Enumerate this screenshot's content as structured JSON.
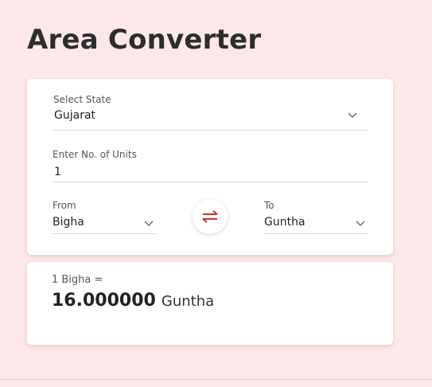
{
  "page_title": "Area Converter",
  "form": {
    "state_label": "Select State",
    "state_value": "Gujarat",
    "units_label": "Enter No. of Units",
    "units_value": "1",
    "from_label": "From",
    "from_value": "Bigha",
    "to_label": "To",
    "to_value": "Guntha",
    "swap_icon": "swap-arrows-icon",
    "chevron_icon": "chevron-down-icon"
  },
  "result": {
    "caption": "1 Bigha =",
    "value": "16.000000",
    "unit": "Guntha"
  },
  "colors": {
    "background": "#fde8e9",
    "card": "#ffffff",
    "swap_icon": "#d32f2f",
    "title": "#2d2d2d"
  }
}
